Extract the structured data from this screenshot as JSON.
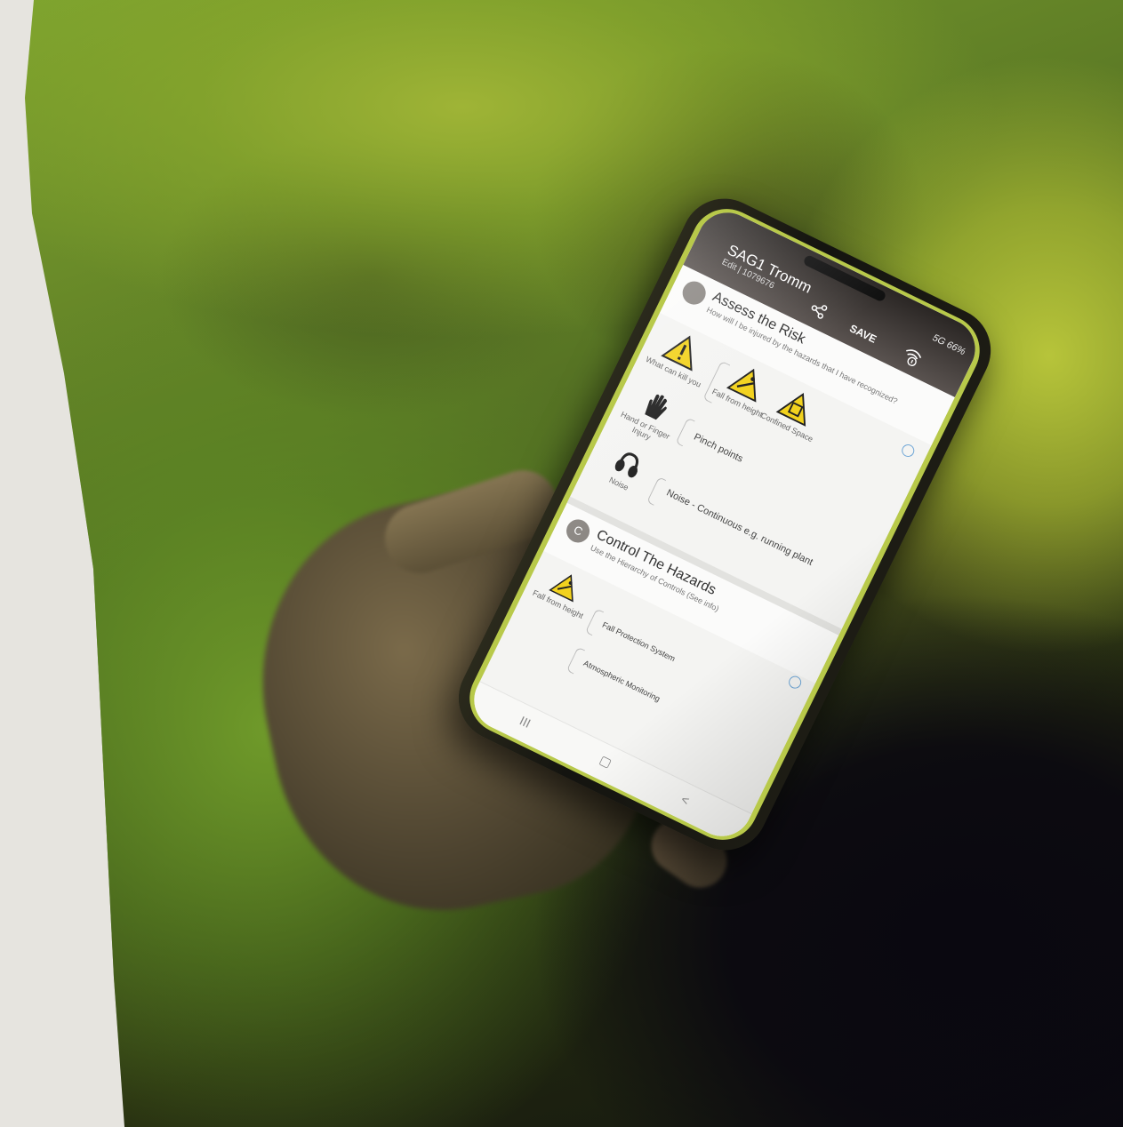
{
  "app": {
    "title": "SAG1 Tromm",
    "subtitle": "Edit | 1079676",
    "save_label": "SAVE",
    "status": "5G 66%"
  },
  "assess": {
    "badge": "",
    "title": "Assess the Risk",
    "subtitle": "How will I be injured by the hazards that I have recognized?",
    "hazards": [
      {
        "label": "What can kill you",
        "icon": "warning-icon"
      },
      {
        "label": "Fall from height",
        "icon": "fall-from-height-icon"
      },
      {
        "label": "Confined Space",
        "icon": "confined-space-icon"
      },
      {
        "label": "Hand or Finger Injury",
        "icon": "hand-icon"
      },
      {
        "label": "Noise",
        "icon": "ear-protection-icon"
      }
    ],
    "items": {
      "pinch": "Pinch points",
      "noise": "Noise - Continuous e.g. running plant"
    }
  },
  "control": {
    "badge": "C",
    "title": "Control The Hazards",
    "subtitle": "Use the Hierarchy of Controls (See info)",
    "hazard_label": "Fall from height",
    "items": [
      "Fall Protection System",
      "Atmospheric Monitoring"
    ]
  },
  "nav": {
    "recents": "III",
    "home": "▢",
    "back": "<"
  },
  "colors": {
    "warning_yellow": "#f2d21e",
    "background_green": "#7ea42e",
    "case_bezel": "#b8c94a"
  }
}
